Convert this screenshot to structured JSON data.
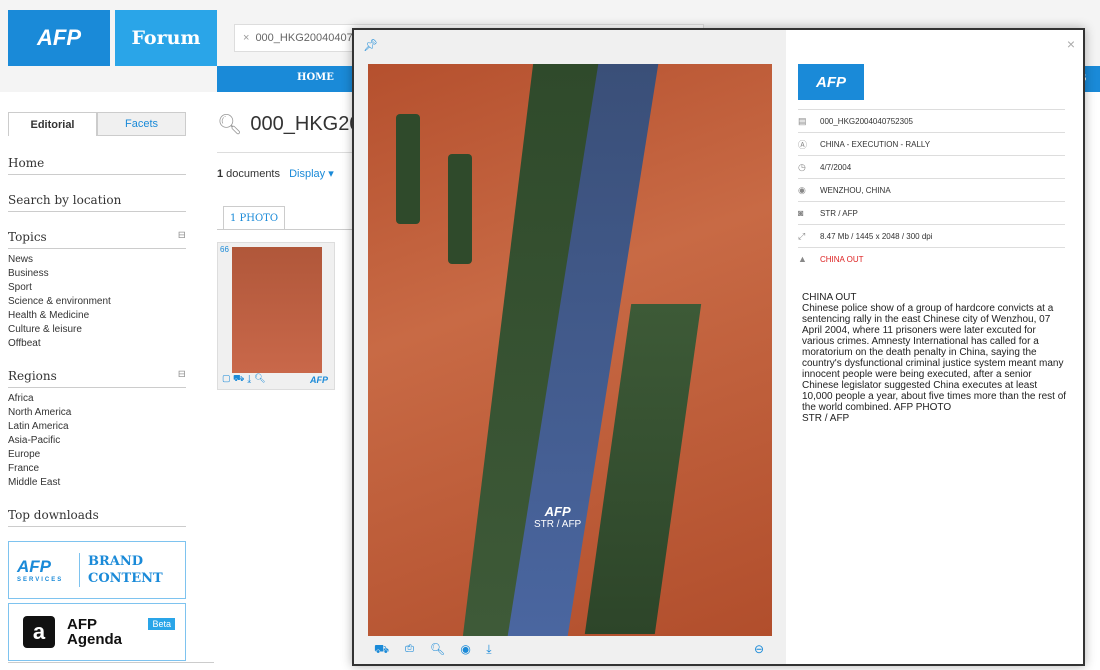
{
  "header": {
    "logo": "AFP",
    "forum": "Forum",
    "search_chip": "000_HKG200404075",
    "nav_home": "HOME",
    "nav_right": "S"
  },
  "sidebar": {
    "tab_editorial": "Editorial",
    "tab_facets": "Facets",
    "home": "Home",
    "search_by_location": "Search by location",
    "topics_title": "Topics",
    "topics": [
      "News",
      "Business",
      "Sport",
      "Science & environment",
      "Health & Medicine",
      "Culture & leisure",
      "Offbeat"
    ],
    "regions_title": "Regions",
    "regions": [
      "Africa",
      "North America",
      "Latin America",
      "Asia-Pacific",
      "Europe",
      "France",
      "Middle East"
    ],
    "top_downloads": "Top downloads",
    "brand_logo": "AFP",
    "brand_services": "SERVICES",
    "brand_l1": "BRAND",
    "brand_l2": "CONTENT",
    "agenda_a": "a",
    "agenda_l1": "AFP",
    "agenda_l2": "Agenda",
    "agenda_beta": "Beta"
  },
  "main": {
    "search_title": "000_HKG20",
    "count": "1",
    "count_label": " documents",
    "display": "Display",
    "photo_tab": "1 PHOTO",
    "thumb_num": "66",
    "thumb_logo": "AFP"
  },
  "modal": {
    "watermark_logo": "AFP",
    "watermark_credit": "STR / AFP",
    "photo_id": "000_HKG2004040752305",
    "logo": "AFP",
    "meta": [
      {
        "icon": "document-icon",
        "text": "000_HKG2004040752305",
        "red": false
      },
      {
        "icon": "title-icon",
        "text": "CHINA - EXECUTION - RALLY",
        "red": false
      },
      {
        "icon": "clock-icon",
        "text": "4/7/2004",
        "red": false
      },
      {
        "icon": "globe-icon",
        "text": "WENZHOU, CHINA",
        "red": false
      },
      {
        "icon": "camera-icon",
        "text": "STR / AFP",
        "red": false
      },
      {
        "icon": "size-icon",
        "text": "8.47 Mb / 1445 x 2048 / 300 dpi",
        "red": false
      },
      {
        "icon": "warning-icon",
        "text": "CHINA OUT",
        "red": true
      }
    ],
    "caption_l1": "CHINA OUT",
    "caption_body": "Chinese police show of a group of hardcore convicts at a sentencing rally in the east Chinese city of Wenzhou, 07 April 2004, where 11 prisoners were later excuted for various crimes. Amnesty International has called for a moratorium on the death penalty in China, saying the country's dysfunctional criminal justice system meant many innocent people were being executed, after a senior Chinese legislator suggested China executes at least 10,000 people a year, about five times more than the rest of the world combined. AFP PHOTO",
    "caption_credit": "STR / AFP"
  },
  "colors": {
    "accent": "#1a8ad8",
    "warning": "#dd2222"
  }
}
